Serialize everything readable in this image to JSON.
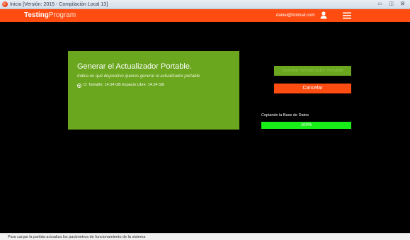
{
  "window": {
    "title": "Inicio   [Versión: 2015 - Compilación Local 13]",
    "minimize_glyph": "▭",
    "maximize_glyph": "◫",
    "close_glyph": "⊠"
  },
  "header": {
    "brand_bold": "Testing",
    "brand_light": "Program",
    "user_email": "daniel@hotmail.com",
    "user_icon": "user-icon",
    "menu_icon": "hamburger-menu-icon"
  },
  "panel": {
    "title": "Generar el Actualizador Portable.",
    "subtitle": "Indica en qué dispositivo quieres generar el actualizador portable",
    "option_label": "D:  Tamaño: 14.54 GB Espacio Libre: 14.34 GB"
  },
  "actions": {
    "generate_label": "Generar Actualizador Portable",
    "cancel_label": "Cancelar"
  },
  "progress": {
    "label": "Copiando la Base de Datos",
    "value_text": "100%",
    "fraction": 1.0
  },
  "statusbar": {
    "text": "Para cargar la partida actualiza los parámetros de funcionamiento de la sistema"
  },
  "colors": {
    "accent_orange": "#ff4d12",
    "panel_green": "#6aa61e",
    "progress_green": "#18ee18"
  }
}
